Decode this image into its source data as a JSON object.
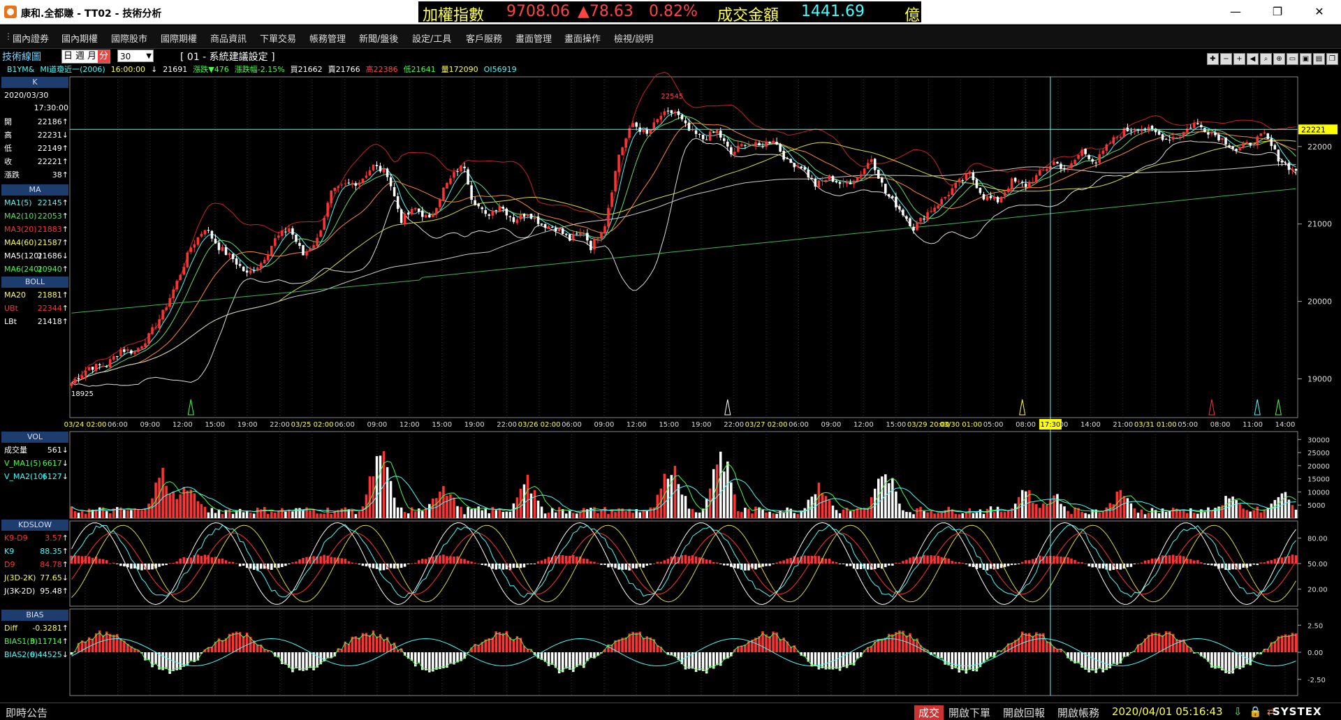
{
  "window": {
    "title": "康和.全都賺 - TT02 - 技術分析"
  },
  "ticker": {
    "index_name": "加權指數",
    "index_value": "9708.06",
    "index_change": "▲78.63",
    "index_pct": "0.82%",
    "turnover_label": "成交金額",
    "turnover_value": "1441.69",
    "turnover_unit": "億"
  },
  "window_buttons": {
    "minimize": "—",
    "maximize": "❐",
    "close": "✕"
  },
  "menu": [
    "國內證券",
    "國內期權",
    "國際股市",
    "國際期權",
    "商品資訊",
    "下單交易",
    "帳務管理",
    "新聞/盤後",
    "設定/工具",
    "客戶服務",
    "畫面管理",
    "畫面操作",
    "檢視/說明"
  ],
  "toolbar": {
    "label": "技術線圖",
    "periods": [
      "日",
      "週",
      "月",
      "分"
    ],
    "selected_period": "分",
    "interval": "30",
    "template": "[ 01 - 系統建議設定 ]"
  },
  "quote": {
    "symbol": "B1YM&",
    "name": "MI道瓊近一(2006)",
    "time": "16:00:00",
    "arrow": "↓",
    "price": "21691",
    "change": "漲跌▼476",
    "change_pct": "漲跌幅-2.15%",
    "bid": "買21662",
    "ask": "賣21766",
    "high": "高22386",
    "low": "低21641",
    "volume": "量172090",
    "oi": "OI56919"
  },
  "panel": {
    "k_header": "K",
    "date": "2020/03/30",
    "time": "17:30:00",
    "ohlc": [
      {
        "label": "開",
        "value": "22186",
        "arrow": "↑"
      },
      {
        "label": "高",
        "value": "22231",
        "arrow": "↓"
      },
      {
        "label": "低",
        "value": "22149",
        "arrow": "↑"
      },
      {
        "label": "收",
        "value": "22221",
        "arrow": "↑"
      },
      {
        "label": "漲跌",
        "value": "38",
        "arrow": "↑"
      }
    ],
    "ma_header": "MA",
    "ma": [
      {
        "label": "MA1(5)",
        "value": "22145",
        "arrow": "↑",
        "color": "#44ffff"
      },
      {
        "label": "MA2(10)",
        "value": "22053",
        "arrow": "↑",
        "color": "#66dd66"
      },
      {
        "label": "MA3(20)",
        "value": "21883",
        "arrow": "↑",
        "color": "#ff3333"
      },
      {
        "label": "MA4(60)",
        "value": "21587",
        "arrow": "↑",
        "color": "#ffff44"
      },
      {
        "label": "MA5(120)",
        "value": "21686",
        "arrow": "↓",
        "color": "#ffffff"
      },
      {
        "label": "MA6(240)",
        "value": "20940",
        "arrow": "↑",
        "color": "#44ff44"
      }
    ],
    "boll_header": "BOLL",
    "boll": [
      {
        "label": "MA20",
        "value": "21881",
        "arrow": "↑",
        "color": "#ffff44"
      },
      {
        "label": "UBt",
        "value": "22344",
        "arrow": "↑",
        "color": "#ff3333"
      },
      {
        "label": "LBt",
        "value": "21418",
        "arrow": "↑",
        "color": "#ffffff"
      }
    ],
    "vol_header": "VOL",
    "vol": [
      {
        "label": "成交量",
        "value": "561",
        "arrow": "↓",
        "color": "#ffffff"
      },
      {
        "label": "V_MA1(5)",
        "value": "6617",
        "arrow": "↓",
        "color": "#44ff44"
      },
      {
        "label": "V_MA2(10)",
        "value": "6127",
        "arrow": "↓",
        "color": "#44ffff"
      }
    ],
    "kd_header": "KDSLOW",
    "kd": [
      {
        "label": "K9-D9",
        "value": "3.57",
        "arrow": "↑",
        "color": "#ff3333"
      },
      {
        "label": "K9",
        "value": "88.35",
        "arrow": "↑",
        "color": "#44ffff"
      },
      {
        "label": "D9",
        "value": "84.78",
        "arrow": "↑",
        "color": "#ff3333"
      },
      {
        "label": "J(3D-2K)",
        "value": "77.65",
        "arrow": "↓",
        "color": "#ffff44"
      },
      {
        "label": "J(3K-2D)",
        "value": "95.48",
        "arrow": "↑",
        "color": "#ffffff"
      }
    ],
    "bias_header": "BIAS",
    "bias": [
      {
        "label": "Diff",
        "value": "-0.3281",
        "arrow": "↑",
        "color": "#ffff44"
      },
      {
        "label": "BIAS1(3)",
        "value": "0.11714",
        "arrow": "↑",
        "color": "#44ff44"
      },
      {
        "label": "BIAS2(6)",
        "value": "0.44525",
        "arrow": "↓",
        "color": "#44ffff"
      }
    ]
  },
  "chart_data": [
    {
      "type": "candlestick",
      "y_ticks": [
        "19000",
        "20000",
        "21000",
        "22000"
      ],
      "ylim": [
        18500,
        22900
      ],
      "price_tag": "22221",
      "high_label": "22545",
      "low_label": "18925",
      "crosshair_label": "17:30",
      "date_labels": [
        "03/24",
        "03/25",
        "03/26",
        "03/27",
        "03/29",
        "03/30",
        "03/31"
      ],
      "x_ticks": [
        "02:00",
        "06:00",
        "09:00",
        "12:00",
        "15:00",
        "19:00",
        "22:00",
        "02:00",
        "06:00",
        "09:00",
        "12:00",
        "15:00",
        "19:00",
        "22:00",
        "02:00",
        "06:00",
        "09:00",
        "12:00",
        "15:00",
        "19:00",
        "22:00",
        "02:00",
        "06:00",
        "09:00",
        "12:00",
        "15:00",
        "20:00",
        "01:00",
        "05:00",
        "08:00",
        "11:00",
        "14:00",
        "21:00",
        "01:00",
        "05:00",
        "08:00",
        "11:00",
        "14:00"
      ],
      "x_tick_labels": [
        "03/24 02:00",
        "06:00",
        "09:00",
        "12:00",
        "15:00",
        "19:00",
        "22:00",
        "03/25 02:00",
        "06:00",
        "09:00",
        "12:00",
        "15:00",
        "19:00",
        "22:00",
        "03/26 02:00",
        "06:00",
        "09:00",
        "12:00",
        "15:00",
        "19:00",
        "22:00",
        "03/27 02:00",
        "06:00",
        "09:00",
        "12:00",
        "15:00",
        "03/29 20:00",
        "03/30 01:00",
        "05:00",
        "08:00",
        "11:00",
        "14:00",
        "21:00",
        "03/31 01:00",
        "05:00",
        "08:00",
        "11:00",
        "14:00"
      ],
      "close_profile": [
        [
          0,
          18950
        ],
        [
          5,
          19150
        ],
        [
          10,
          19180
        ],
        [
          14,
          19380
        ],
        [
          18,
          19350
        ],
        [
          22,
          19550
        ],
        [
          26,
          19850
        ],
        [
          30,
          20250
        ],
        [
          34,
          20700
        ],
        [
          38,
          20950
        ],
        [
          42,
          20700
        ],
        [
          46,
          20550
        ],
        [
          50,
          20350
        ],
        [
          54,
          20500
        ],
        [
          58,
          20800
        ],
        [
          62,
          20950
        ],
        [
          66,
          20600
        ],
        [
          70,
          20800
        ],
        [
          74,
          21400
        ],
        [
          78,
          21500
        ],
        [
          82,
          21550
        ],
        [
          86,
          21750
        ],
        [
          90,
          21650
        ],
        [
          94,
          21050
        ],
        [
          98,
          21200
        ],
        [
          102,
          21050
        ],
        [
          106,
          21450
        ],
        [
          110,
          21700
        ],
        [
          112,
          21750
        ],
        [
          114,
          21350
        ],
        [
          118,
          21100
        ],
        [
          122,
          21250
        ],
        [
          126,
          21050
        ],
        [
          130,
          21150
        ],
        [
          134,
          21000
        ],
        [
          138,
          20950
        ],
        [
          142,
          20800
        ],
        [
          146,
          20900
        ],
        [
          148,
          20700
        ],
        [
          152,
          21000
        ],
        [
          156,
          21900
        ],
        [
          160,
          22300
        ],
        [
          164,
          22150
        ],
        [
          168,
          22400
        ],
        [
          172,
          22450
        ],
        [
          176,
          22200
        ],
        [
          180,
          22100
        ],
        [
          184,
          22200
        ],
        [
          188,
          21900
        ],
        [
          192,
          22050
        ],
        [
          196,
          22000
        ],
        [
          200,
          22100
        ],
        [
          204,
          21800
        ],
        [
          208,
          21750
        ],
        [
          212,
          21500
        ],
        [
          216,
          21600
        ],
        [
          220,
          21500
        ],
        [
          224,
          21600
        ],
        [
          228,
          21850
        ],
        [
          232,
          21400
        ],
        [
          236,
          21200
        ],
        [
          240,
          20950
        ],
        [
          244,
          21150
        ],
        [
          248,
          21300
        ],
        [
          252,
          21500
        ],
        [
          256,
          21650
        ],
        [
          260,
          21350
        ],
        [
          264,
          21300
        ],
        [
          268,
          21550
        ],
        [
          272,
          21500
        ],
        [
          276,
          21650
        ],
        [
          280,
          21800
        ],
        [
          284,
          21700
        ],
        [
          288,
          21950
        ],
        [
          292,
          21800
        ],
        [
          296,
          22050
        ],
        [
          300,
          22200
        ],
        [
          304,
          22250
        ],
        [
          308,
          22200
        ],
        [
          312,
          22100
        ],
        [
          316,
          22150
        ],
        [
          320,
          22300
        ],
        [
          324,
          22200
        ],
        [
          328,
          22100
        ],
        [
          332,
          21950
        ],
        [
          336,
          22050
        ],
        [
          340,
          22150
        ],
        [
          344,
          21850
        ],
        [
          348,
          21700
        ]
      ],
      "signal_arrows": [
        {
          "bar": 34,
          "color": "#44ff44"
        },
        {
          "bar": 187,
          "color": "#ffffff"
        },
        {
          "bar": 271,
          "color": "#ffff44"
        },
        {
          "bar": 325,
          "color": "#ff3333"
        },
        {
          "bar": 338,
          "color": "#44ffff"
        },
        {
          "bar": 344,
          "color": "#44ff44"
        }
      ]
    },
    {
      "type": "bar",
      "name": "VOL",
      "y_ticks": [
        "5000",
        "10000",
        "15000",
        "20000",
        "25000",
        "30000"
      ],
      "ylim": [
        0,
        33000
      ]
    },
    {
      "type": "line",
      "name": "KDSLOW",
      "y_ticks": [
        "20.00",
        "50.00",
        "80.00"
      ],
      "ylim": [
        0,
        100
      ]
    },
    {
      "type": "line",
      "name": "BIAS",
      "y_ticks": [
        "2.50",
        "0.00",
        "-2.50"
      ],
      "ylim": [
        -4,
        4
      ]
    }
  ],
  "status": {
    "notice": "即時公告",
    "trade": "成交",
    "open_order": "開啟下單",
    "open_report": "開啟回報",
    "open_account": "開啟帳務",
    "datetime": "2020/04/01 05:16:43",
    "brand": "SYSTEX"
  }
}
